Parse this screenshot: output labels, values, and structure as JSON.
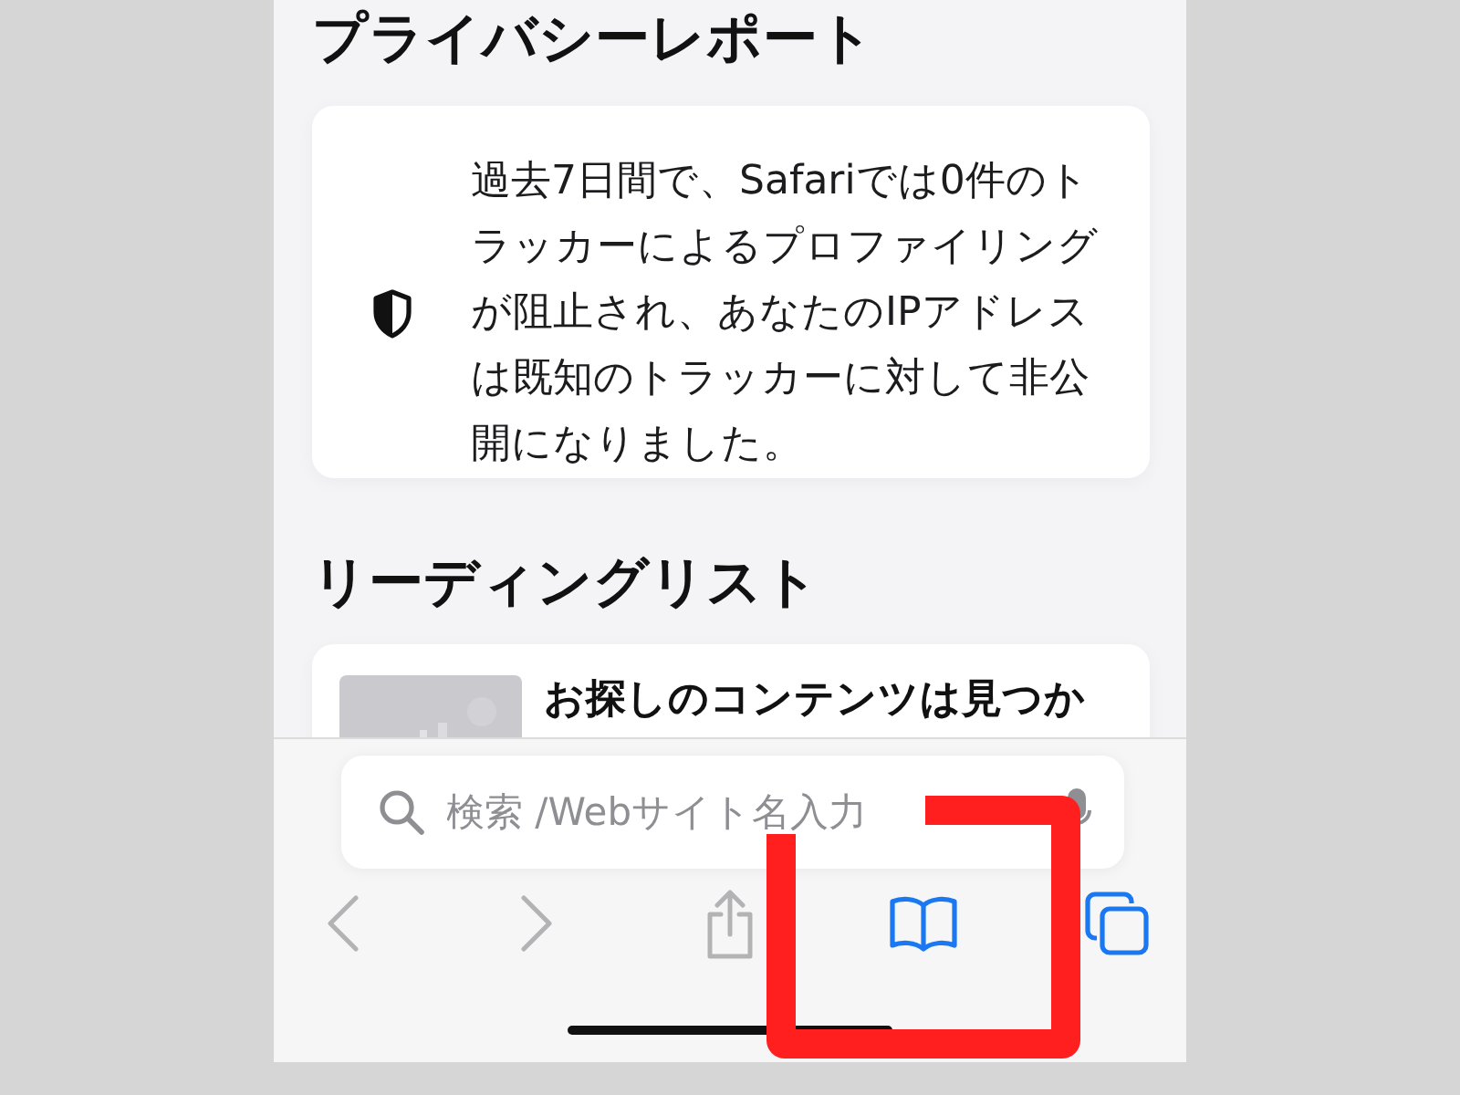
{
  "privacy_report": {
    "heading": "プライバシーレポート",
    "text": "過去7日間で、Safariでは0件のトラッカーによるプロファイリングが阻止され、あなたのIPアドレスは既知のトラッカーに対して非公開になりました。"
  },
  "reading_list": {
    "heading": "リーディングリスト",
    "items": [
      {
        "title": "お探しのコンテンツは見つか"
      }
    ]
  },
  "search": {
    "placeholder": "検索 /Webサイト名入力"
  },
  "toolbar": [
    {
      "kind": "back",
      "disabled": true,
      "highlighted": false
    },
    {
      "kind": "forward",
      "disabled": true,
      "highlighted": false
    },
    {
      "kind": "share",
      "disabled": true,
      "highlighted": false
    },
    {
      "kind": "bookmarks",
      "disabled": false,
      "highlighted": true
    },
    {
      "kind": "tabs",
      "disabled": false,
      "highlighted": false
    }
  ]
}
